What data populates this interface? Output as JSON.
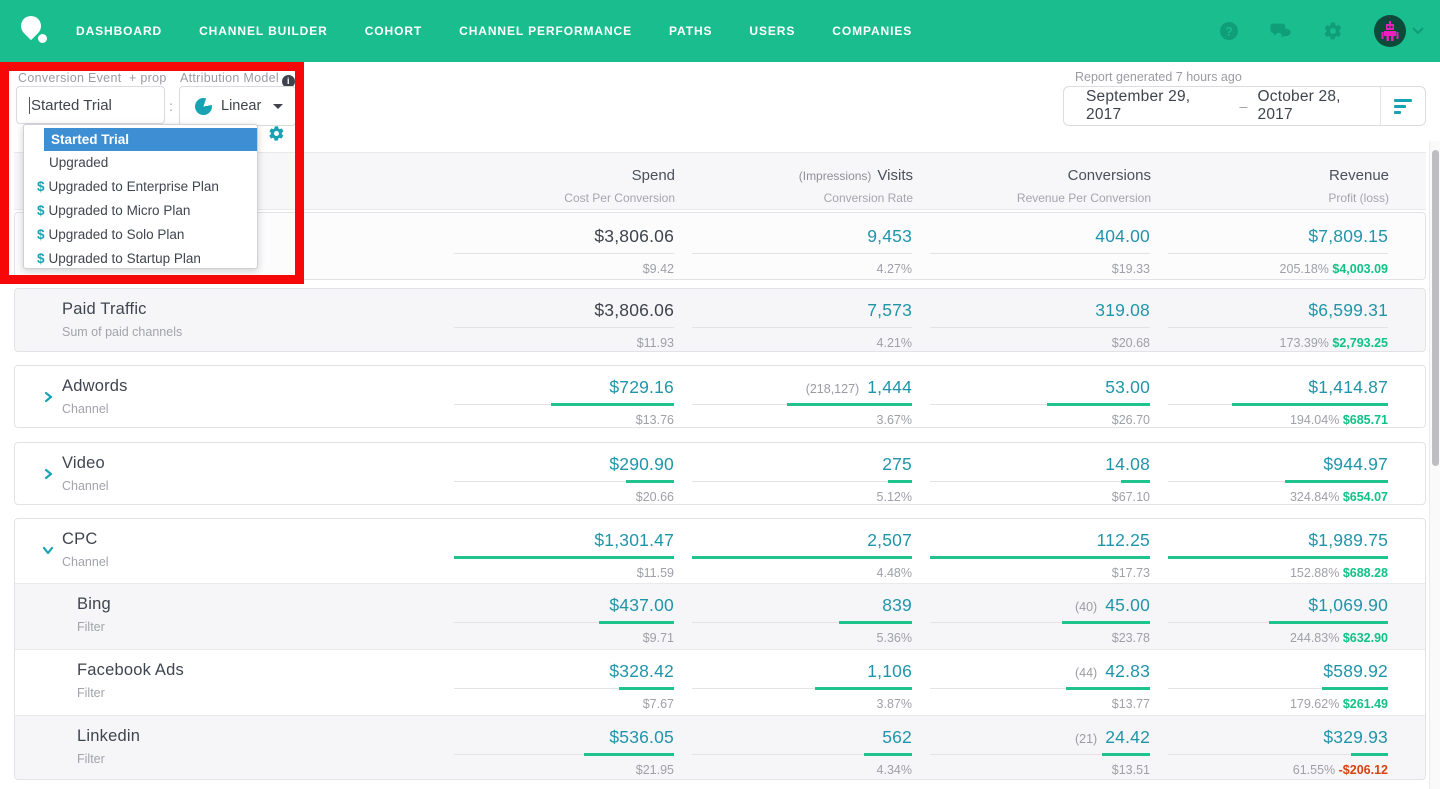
{
  "nav": {
    "items": [
      "DASHBOARD",
      "CHANNEL BUILDER",
      "COHORT",
      "CHANNEL PERFORMANCE",
      "PATHS",
      "USERS",
      "COMPANIES"
    ],
    "help_glyph": "?"
  },
  "filters": {
    "conversion_event_label": "Conversion Event",
    "add_prop_label": "+ prop",
    "conversion_event_value": "Started Trial",
    "separator": ":",
    "attribution_model_label": "Attribution Model",
    "model_value": "Linear",
    "hidden_separator": ":",
    "dropdown_options": {
      "selected": "Started Trial",
      "plain": "Upgraded",
      "money": [
        "Upgraded to Enterprise Plan",
        "Upgraded to Micro Plan",
        "Upgraded to Solo Plan",
        "Upgraded to Startup Plan"
      ],
      "dollar": "$"
    }
  },
  "report": {
    "generated_note": "Report generated 7 hours ago",
    "date_start": "September 29, 2017",
    "date_separator": "–",
    "date_end": "October 28, 2017"
  },
  "table": {
    "headers": {
      "spend": "Spend",
      "spend_sub": "Cost Per Conversion",
      "visits_pre": "(Impressions)",
      "visits": "Visits",
      "visits_sub": "Conversion Rate",
      "conversions": "Conversions",
      "conversions_sub": "Revenue Per Conversion",
      "revenue": "Revenue",
      "revenue_sub": "Profit (loss)"
    },
    "rows": [
      {
        "name": "",
        "sublabel": "",
        "spend": "$3,806.06",
        "cpc": "$9.42",
        "spend_color": "#3e434d",
        "visits": "9,453",
        "rate": "4.27%",
        "conversions": "404.00",
        "rpc": "$19.33",
        "revenue": "$7,809.15",
        "roi": "205.18%",
        "profit": "$4,003.09",
        "profit_color": "#12c186",
        "bars": [
          0,
          0,
          0,
          0
        ]
      },
      {
        "name": "Paid Traffic",
        "sublabel": "Sum of paid channels",
        "spend": "$3,806.06",
        "cpc": "$11.93",
        "spend_color": "#3e434d",
        "visits": "7,573",
        "rate": "4.21%",
        "conversions": "319.08",
        "rpc": "$20.68",
        "revenue": "$6,599.31",
        "roi": "173.39%",
        "profit": "$2,793.25",
        "profit_color": "#12c186",
        "bars": [
          0,
          0,
          0,
          0
        ]
      },
      {
        "name": "Adwords",
        "sublabel": "Channel",
        "spend": "$729.16",
        "cpc": "$13.76",
        "spend_color": "#2095a9",
        "visits_pre": "(218,127)",
        "visits": "1,444",
        "rate": "3.67%",
        "conversions": "53.00",
        "rpc": "$26.70",
        "revenue": "$1,414.87",
        "roi": "194.04%",
        "profit": "$685.71",
        "profit_color": "#12c186",
        "bars": [
          0.56,
          0.57,
          0.47,
          0.71
        ]
      },
      {
        "name": "Video",
        "sublabel": "Channel",
        "spend": "$290.90",
        "cpc": "$20.66",
        "spend_color": "#2095a9",
        "visits": "275",
        "rate": "5.12%",
        "conversions": "14.08",
        "rpc": "$67.10",
        "revenue": "$944.97",
        "roi": "324.84%",
        "profit": "$654.07",
        "profit_color": "#12c186",
        "bars": [
          0.22,
          0.11,
          0.13,
          0.47
        ]
      },
      {
        "name": "CPC",
        "sublabel": "Channel",
        "spend": "$1,301.47",
        "cpc": "$11.59",
        "spend_color": "#2095a9",
        "visits": "2,507",
        "rate": "4.48%",
        "conversions": "112.25",
        "rpc": "$17.73",
        "revenue": "$1,989.75",
        "roi": "152.88%",
        "profit": "$688.28",
        "profit_color": "#12c186",
        "bars": [
          1,
          1,
          1,
          1
        ]
      },
      {
        "name": "Bing",
        "sublabel": "Filter",
        "spend": "$437.00",
        "cpc": "$9.71",
        "spend_color": "#2095a9",
        "visits": "839",
        "rate": "5.36%",
        "conv_pre": "(40)",
        "conversions": "45.00",
        "rpc": "$23.78",
        "revenue": "$1,069.90",
        "roi": "244.83%",
        "profit": "$632.90",
        "profit_color": "#12c186",
        "bars": [
          0.34,
          0.33,
          0.4,
          0.54
        ]
      },
      {
        "name": "Facebook Ads",
        "sublabel": "Filter",
        "spend": "$328.42",
        "cpc": "$7.67",
        "spend_color": "#2095a9",
        "visits": "1,106",
        "rate": "3.87%",
        "conv_pre": "(44)",
        "conversions": "42.83",
        "rpc": "$13.77",
        "revenue": "$589.92",
        "roi": "179.62%",
        "profit": "$261.49",
        "profit_color": "#12c186",
        "bars": [
          0.25,
          0.44,
          0.38,
          0.3
        ]
      },
      {
        "name": "Linkedin",
        "sublabel": "Filter",
        "spend": "$536.05",
        "cpc": "$21.95",
        "spend_color": "#2095a9",
        "visits": "562",
        "rate": "4.34%",
        "conv_pre": "(21)",
        "conversions": "24.42",
        "rpc": "$13.51",
        "revenue": "$329.93",
        "roi": "61.55%",
        "profit": "-$206.12",
        "profit_color": "#d6430e",
        "bars": [
          0.41,
          0.22,
          0.22,
          0.17
        ]
      }
    ]
  },
  "colors": {
    "nav_green": "#1abd8e",
    "value_teal": "#2095a9",
    "bar_green": "#1ec48c",
    "profit_green": "#12c186",
    "loss_red": "#d6430e",
    "highlight_blue": "#3d8ed2",
    "annotation_red": "#f70808"
  }
}
